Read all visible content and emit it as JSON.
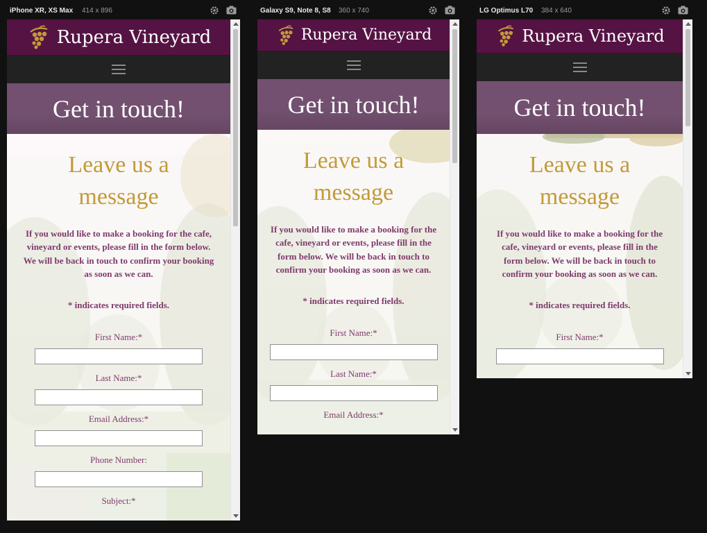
{
  "devices": [
    {
      "name": "iPhone XR, XS Max",
      "size": "414 x 896",
      "settings_icon": "gear-icon",
      "screenshot_icon": "camera-icon"
    },
    {
      "name": "Galaxy S9, Note 8, S8",
      "size": "360 x 740",
      "settings_icon": "gear-icon",
      "screenshot_icon": "camera-icon"
    },
    {
      "name": "LG Optimus L70",
      "size": "384 x 640",
      "settings_icon": "gear-icon",
      "screenshot_icon": "camera-icon"
    }
  ],
  "site": {
    "brand": "Rupera Vineyard",
    "logo_icon": "grape-icon",
    "menu_icon": "hamburger-icon",
    "hero_title": "Get in touch!",
    "section_title_line1": "Leave us a",
    "section_title_line2": "message",
    "intro": "If you would like to make a booking for the cafe, vineyard or events, please fill in the form below. We will be back in touch to confirm your booking as soon as we can.",
    "required_note": "* indicates required fields.",
    "labels": {
      "first_name": "First Name:*",
      "last_name": "Last Name:*",
      "email": "Email Address:*",
      "phone": "Phone Number:",
      "subject": "Subject:*"
    },
    "values": {
      "first_name": "",
      "last_name": "",
      "email": "",
      "phone": ""
    }
  },
  "colors": {
    "brand_purple": "#551344",
    "nav_dark": "#222222",
    "hero_mauve": "#735070",
    "gold": "#c39a3a",
    "text_plum": "#7f3a6c",
    "toolbar_bg": "#111111"
  }
}
